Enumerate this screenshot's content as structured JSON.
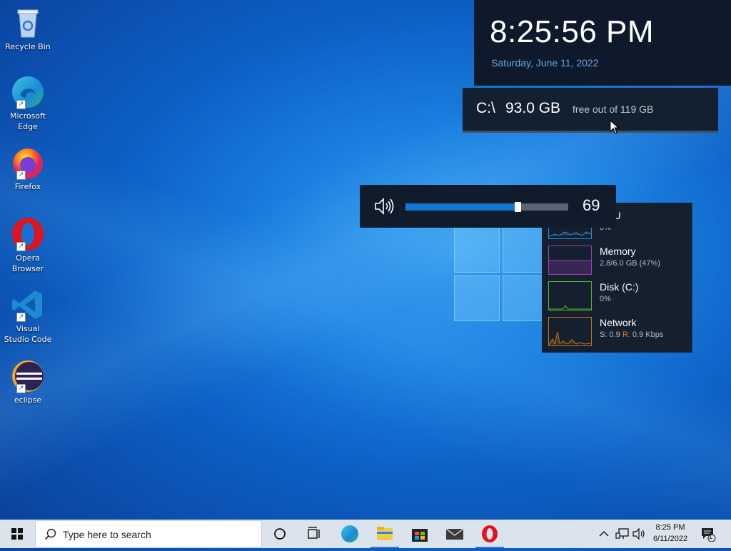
{
  "desktop": {
    "icons": [
      {
        "label": "Recycle Bin"
      },
      {
        "label": "Microsoft Edge"
      },
      {
        "label": "Firefox"
      },
      {
        "label": "Opera Browser"
      },
      {
        "label": "Visual Studio Code"
      },
      {
        "label": "eclipse"
      }
    ]
  },
  "clock_widget": {
    "time": "8:25:56 PM",
    "date": "Saturday, June 11, 2022"
  },
  "disk_widget": {
    "drive": "C:\\",
    "free": "93.0 GB",
    "total_text": "free out of 119 GB"
  },
  "volume_widget": {
    "value": "69",
    "level_percent": 69
  },
  "perf_widget": {
    "cpu": {
      "name": "CPU",
      "stat": "0%",
      "color": "#2a8fd6"
    },
    "memory": {
      "name": "Memory",
      "stat": "2.8/6.0 GB (47%)",
      "color": "#a23cc4"
    },
    "disk": {
      "name": "Disk (C:)",
      "stat": "0%",
      "color": "#59b52a"
    },
    "network": {
      "name": "Network",
      "send_label": "S:",
      "send": "0.9",
      "recv_label": "R:",
      "recv": "0.9 Kbps",
      "color": "#c7701f"
    }
  },
  "taskbar": {
    "search_placeholder": "Type here to search",
    "apps": [
      "cortana-icon",
      "task-view-icon",
      "edge-icon",
      "file-explorer-icon",
      "store-icon",
      "mail-icon",
      "opera-icon"
    ],
    "tray_time": "8:25 PM",
    "tray_date": "6/11/2022",
    "notification_count": "1"
  }
}
